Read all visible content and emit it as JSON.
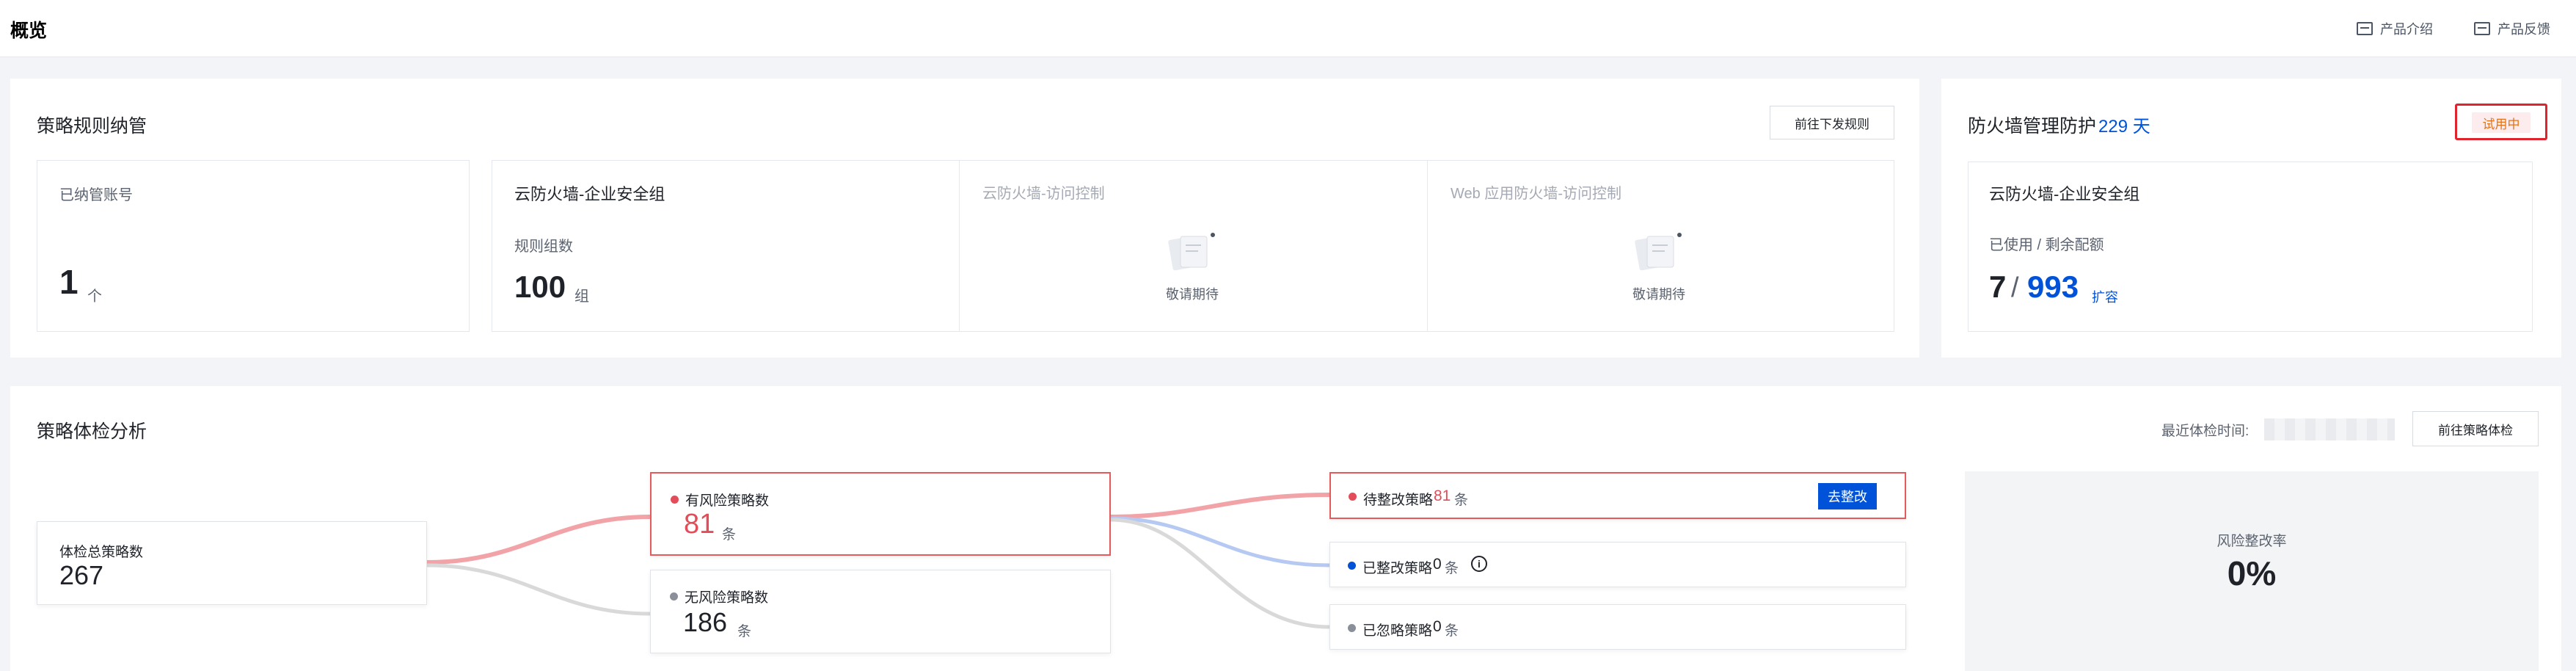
{
  "header": {
    "title": "概览",
    "links": [
      {
        "label": "产品介绍",
        "icon": "feedback-icon"
      },
      {
        "label": "产品反馈",
        "icon": "feedback-icon"
      }
    ]
  },
  "rules_card": {
    "title": "策略规则纳管",
    "button": "前往下发规则",
    "managed_accounts": {
      "label": "已纳管账号",
      "value": "1",
      "unit": "个"
    },
    "security_group": {
      "title": "云防火墙-企业安全组",
      "label": "规则组数",
      "value": "100",
      "unit": "组"
    },
    "access_control": {
      "title": "云防火墙-访问控制",
      "note": "敬请期待"
    },
    "waf_control": {
      "title": "Web 应用防火墙-访问控制",
      "note": "敬请期待"
    }
  },
  "protect_card": {
    "title": "防火墙管理防护",
    "days": "229 天",
    "badge": "试用中",
    "group_title": "云防火墙-企业安全组",
    "usage_label": "已使用 / 剩余配额",
    "used": "7",
    "separator": "/",
    "remaining": "993",
    "expand": "扩容"
  },
  "analysis_card": {
    "title": "策略体检分析",
    "last_check_label": "最近体检时间:",
    "button": "前往策略体检",
    "total": {
      "label": "体检总策略数",
      "value": "267"
    },
    "risk": {
      "label": "有风险策略数",
      "value": "81",
      "unit": "条"
    },
    "norisk": {
      "label": "无风险策略数",
      "value": "186",
      "unit": "条"
    },
    "pending": {
      "label": "待整改策略",
      "value": "81",
      "unit": "条",
      "action": "去整改"
    },
    "fixed": {
      "label": "已整改策略",
      "value": "0",
      "unit": "条"
    },
    "ignored": {
      "label": "已忽略策略",
      "value": "0",
      "unit": "条"
    },
    "rate": {
      "label": "风险整改率",
      "value": "0%"
    }
  },
  "colors": {
    "brand_blue": "#0052d9",
    "risk_red": "#e34d59",
    "badge_bg": "#fdecee",
    "badge_text": "#e37318",
    "highlight_box": "#e0242d"
  }
}
